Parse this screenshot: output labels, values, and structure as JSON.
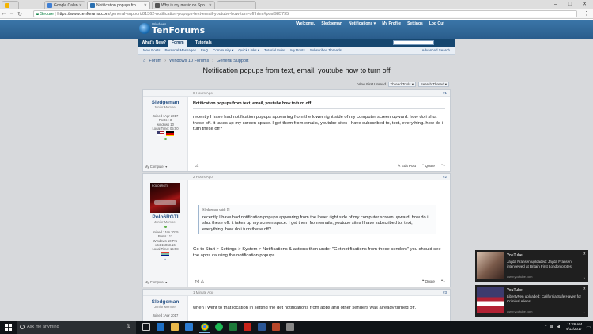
{
  "browser": {
    "tabs": [
      {
        "label": "Google Calendar - Wee",
        "color": "#3f7fd4",
        "active": false
      },
      {
        "label": "Notification popups fro",
        "color": "#2a6fb0",
        "active": true
      },
      {
        "label": "Why is my music on Spo",
        "color": "#555555",
        "active": false
      }
    ],
    "url_secure": "Secure",
    "url_host": "https://www.tenforums.com",
    "url_path": "/general-support/81362-notification-popups-text-email-youtube-how-turn-off.html#post985795"
  },
  "site": {
    "logo_small": "Windows",
    "logo_big": "TenForums",
    "top_links": [
      "Welcome,",
      "Sledgeman",
      "Notifications ▾",
      "My Profile",
      "Settings",
      "Log Out"
    ],
    "nav_tabs": [
      "What's New?",
      "Forum",
      "Tutorials"
    ],
    "sub_links": [
      "New Posts",
      "Personal Messages",
      "FAQ",
      "Community ▾",
      "Quick Links ▾",
      "Tutorial Index",
      "My Posts",
      "Subscribed Threads"
    ],
    "advanced_search": "Advanced Search",
    "breadcrumb": [
      "Forum",
      "Windows 10 Forums",
      "General Support"
    ],
    "thread_title": "Notification popups from text, email, youtube how to turn off",
    "tools": {
      "first_unread": "View First Unread",
      "thread_tools": "Thread Tools ▾",
      "search_thread": "Search Thread ▾"
    }
  },
  "posts": [
    {
      "time": "8 Hours Ago",
      "number": "#1",
      "user": "Sledgeman",
      "rank": "Junior Member",
      "info": [
        "Joined : Apr 2017",
        "Posts : 3",
        "windows 10",
        "Local Time: 05:50"
      ],
      "title": "Notification popups from text, email, youtube how to turn off",
      "text": "recently I have had notification popups appearing from the lower right side of my computer screen upward. how do i shut these off. it takes up my screen space. I get them from emails, youtube sites I have subscribed to, text, everything. how do i turn these off?",
      "my_computer": "My Computer ▾",
      "edit": "Edit Post",
      "quote": "Quote"
    },
    {
      "time": "2 Hours Ago",
      "number": "#2",
      "user": "Polo6RGTI",
      "rank": "Junior Member",
      "avatar_text": "POLO6RGTI",
      "info": [
        "Joined : Jan 2015",
        "Posts : 11",
        "Windows 10 Pro",
        "x64 15063.16",
        "Local Time: 15:58"
      ],
      "quote_by": "Sledgeman said: ⊡",
      "quote_text": "recently I have had notification popups appearing from the lower right side of my computer screen upward. how do i shut these off. it takes up my screen space. I get them from emails, youtube sites I have subscribed to, text, everything. how do i turn these off?",
      "text": "Go to Start > Settings > System > Notifications & actions then under \"Get notifications from these senders\" you should see the apps causing the notification popups.",
      "my_computer": "My Computer ▾",
      "quote": "Quote"
    },
    {
      "time": "1 Minute Ago",
      "number": "#3",
      "user": "Sledgeman",
      "rank": "Junior Member",
      "info": [
        "Joined : Apr 2017"
      ],
      "text": "when i went to that location in setting the get notifications from apps and other senders was already turned off."
    }
  ],
  "notifications": [
    {
      "app": "YouTube",
      "message": "Jayda Fransen uploaded: Jayda Fransen interviewed at Britain First London protest",
      "source": "www.youtube.com"
    },
    {
      "app": "YouTube",
      "message": "LibertyPen uploaded: California Safe Haven for Criminal Aliens",
      "source": "www.youtube.com"
    }
  ],
  "taskbar": {
    "search_placeholder": "Ask me anything",
    "time": "11:26 AM",
    "date": "4/12/2017"
  }
}
